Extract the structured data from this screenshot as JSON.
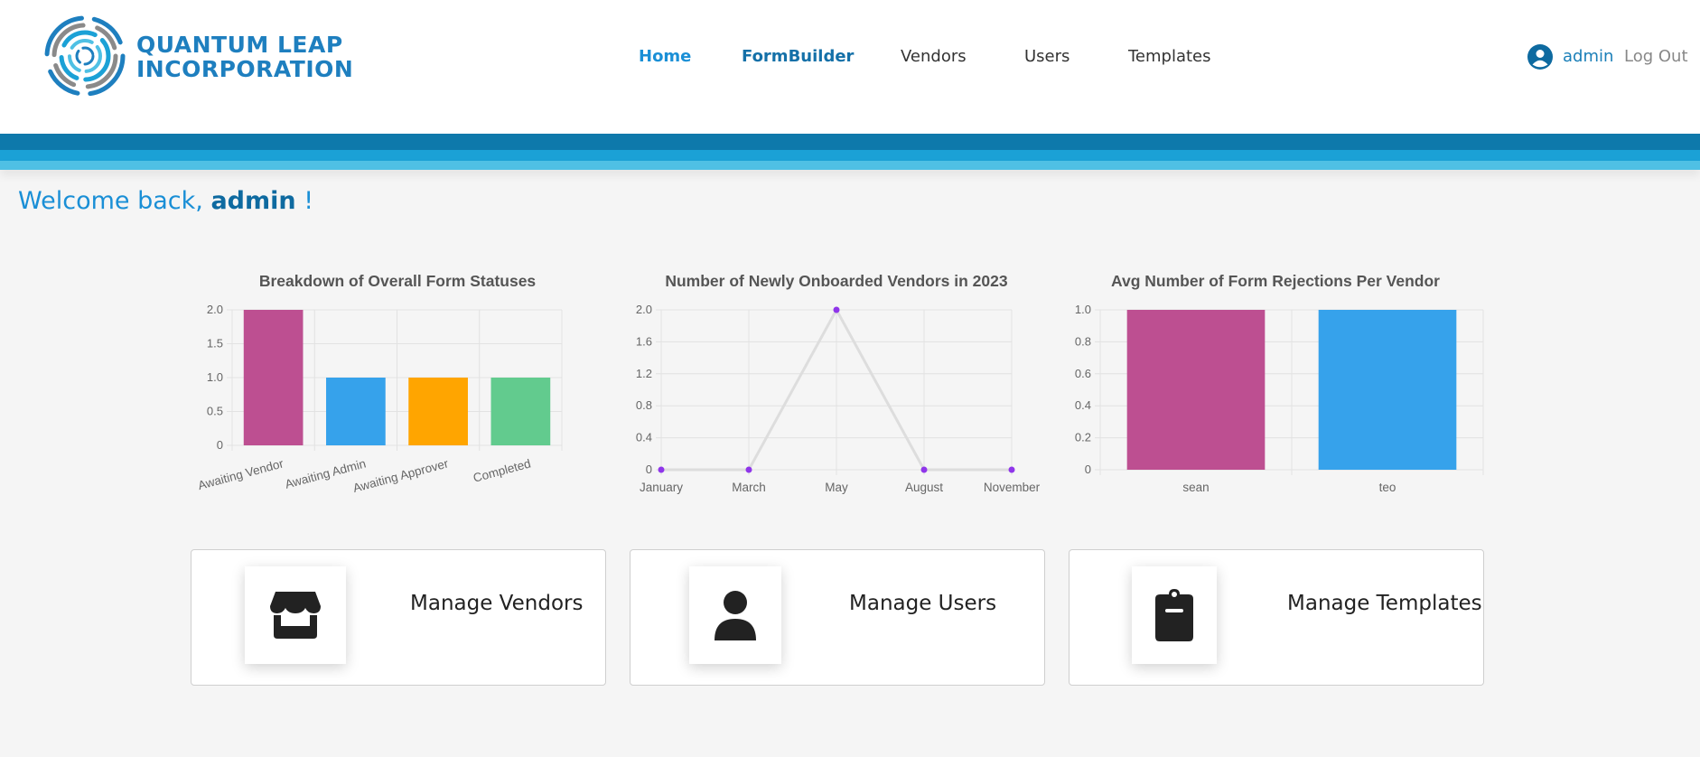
{
  "brand": {
    "line1": "QUANTUM LEAP",
    "line2": "INCORPORATION"
  },
  "nav": [
    {
      "label": "Home"
    },
    {
      "label": "FormBuilder"
    },
    {
      "label": "Vendors"
    },
    {
      "label": "Users"
    },
    {
      "label": "Templates"
    }
  ],
  "user": {
    "name": "admin",
    "logout_label": "Log Out"
  },
  "welcome": {
    "prefix": "Welcome back,",
    "name": "admin",
    "suffix": "!"
  },
  "colors": {
    "magenta": "#bd4f91",
    "blue": "#36a2eb",
    "orange": "#ffa500",
    "green": "#62cb8e",
    "purple": "#8f35ea",
    "brand": "#1e7fbf"
  },
  "chart_data": [
    {
      "type": "bar",
      "title": "Breakdown of Overall Form Statuses",
      "categories": [
        "Awaiting Vendor",
        "Awaiting Admin",
        "Awaiting Approver",
        "Completed"
      ],
      "values": [
        2,
        1,
        1,
        1
      ],
      "bar_colors": [
        "#bd4f91",
        "#36a2eb",
        "#ffa500",
        "#62cb8e"
      ],
      "ylim": [
        0,
        2
      ],
      "yticks": [
        "0",
        "0.5",
        "1.0",
        "1.5",
        "2.0"
      ],
      "grid": true
    },
    {
      "type": "line",
      "title": "Number of Newly Onboarded Vendors in 2023",
      "categories": [
        "January",
        "March",
        "May",
        "August",
        "November"
      ],
      "values": [
        0,
        0,
        2,
        0,
        0
      ],
      "ylim": [
        0,
        2
      ],
      "yticks": [
        "0",
        "0.4",
        "0.8",
        "1.2",
        "1.6",
        "2.0"
      ],
      "point_color": "#8f35ea",
      "line_color": "#dddddd",
      "grid": true
    },
    {
      "type": "bar",
      "title": "Avg Number of Form Rejections Per Vendor",
      "categories": [
        "sean",
        "teo"
      ],
      "values": [
        1,
        1
      ],
      "bar_colors": [
        "#bd4f91",
        "#36a2eb"
      ],
      "ylim": [
        0,
        1
      ],
      "yticks": [
        "0",
        "0.2",
        "0.4",
        "0.6",
        "0.8",
        "1.0"
      ],
      "grid": true
    }
  ],
  "cards": [
    {
      "label": "Manage Vendors",
      "icon": "store-icon"
    },
    {
      "label": "Manage Users",
      "icon": "user-icon"
    },
    {
      "label": "Manage Templates",
      "icon": "clipboard-icon"
    }
  ]
}
